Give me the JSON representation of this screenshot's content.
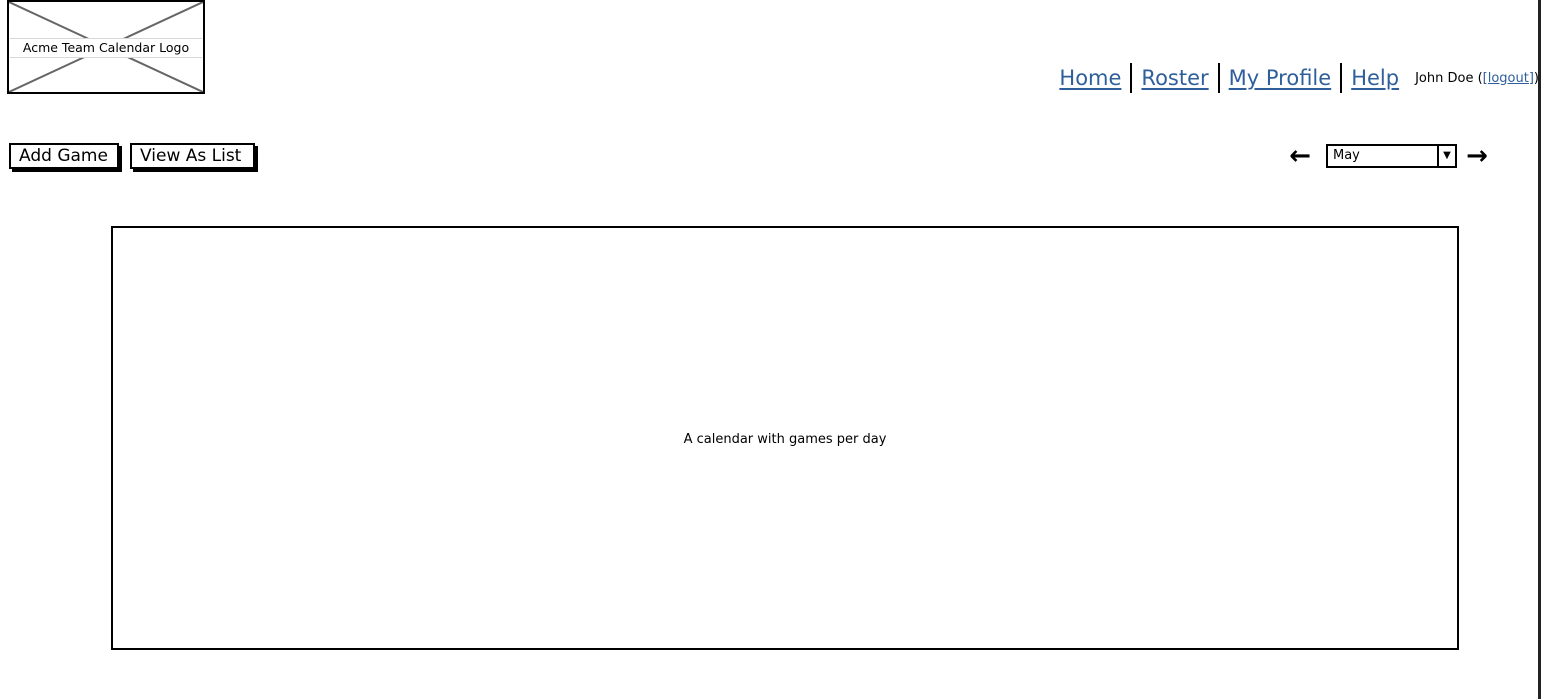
{
  "header": {
    "logo_label": "Acme Team Calendar Logo"
  },
  "nav": {
    "items": [
      {
        "label": "Home"
      },
      {
        "label": "Roster"
      },
      {
        "label": "My Profile"
      },
      {
        "label": "Help"
      }
    ],
    "user_name": "John Doe (",
    "logout_label": "[logout]",
    "user_suffix": ")"
  },
  "actions": {
    "add_game_label": "Add Game",
    "view_as_list_label": "View As List"
  },
  "month_picker": {
    "prev_icon": "arrow-left-icon",
    "next_icon": "arrow-right-icon",
    "selected_month": "May",
    "prev_glyph": "←",
    "next_glyph": "→",
    "caret_glyph": "▼"
  },
  "calendar": {
    "placeholder_text": "A calendar with games per day"
  }
}
